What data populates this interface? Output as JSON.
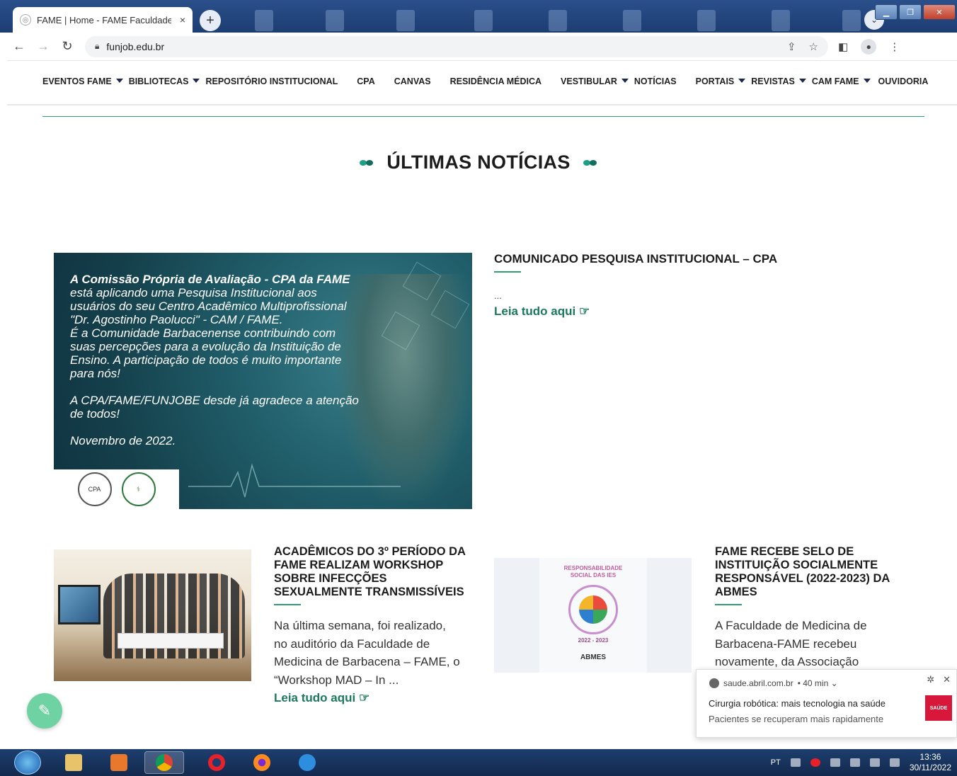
{
  "browser": {
    "tab_title": "FAME | Home - FAME Faculdade de",
    "tab_close": "×",
    "new_tab": "+",
    "url": "funjob.edu.br"
  },
  "nav": {
    "items": [
      {
        "label": "EVENTOS FAME",
        "dropdown": true
      },
      {
        "label": "BIBLIOTECAS",
        "dropdown": true
      },
      {
        "label": "REPOSITÓRIO INSTITUCIONAL",
        "dropdown": false
      },
      {
        "label": "CPA",
        "dropdown": false
      },
      {
        "label": "CANVAS",
        "dropdown": false
      },
      {
        "label": "RESIDÊNCIA MÉDICA",
        "dropdown": false
      },
      {
        "label": "VESTIBULAR",
        "dropdown": true
      },
      {
        "label": "NOTÍCIAS",
        "dropdown": false
      },
      {
        "label": "PORTAIS",
        "dropdown": true
      },
      {
        "label": "REVISTAS",
        "dropdown": true
      },
      {
        "label": "CAM FAME",
        "dropdown": true
      },
      {
        "label": "OUVIDORIA",
        "dropdown": false
      }
    ]
  },
  "section": {
    "heading": "ÚLTIMAS NOTÍCIAS"
  },
  "featured": {
    "image_text": {
      "line1": "A Comissão Própria de Avaliação - CPA da FAME",
      "line2": "está aplicando uma Pesquisa Institucional aos",
      "line3": "usuários do seu Centro Acadêmico Multiprofissional",
      "line4": "\"Dr. Agostinho Paolucci\" - CAM / FAME.",
      "line5": "É a Comunidade Barbacenense contribuindo com",
      "line6": "suas percepções para a evolução da Instituição de",
      "line7": "Ensino. A participação de todos é muito importante",
      "line8": "para nós!",
      "line9": "A CPA/FAME/FUNJOBE desde já agradece a atenção",
      "line10": "de todos!",
      "line11": "Novembro de 2022.",
      "logo1": "CPA"
    },
    "title": "COMUNICADO PESQUISA INSTITUCIONAL – CPA",
    "excerpt": "...",
    "read_more": "Leia tudo aqui"
  },
  "card1": {
    "title_l1": "ACADÊMICOS DO 3º PERÍODO DA",
    "title_l2": "FAME REALIZAM WORKSHOP",
    "title_l3": "SOBRE INFECÇÕES",
    "title_l4": "SEXUALMENTE TRANSMISSÍVEIS",
    "body_l1": "Na última semana, foi realizado,",
    "body_l2": "no auditório da Faculdade de",
    "body_l3": "Medicina de Barbacena – FAME, o",
    "body_l4": "“Workshop MAD – In ...",
    "read_more": "Leia tudo aqui"
  },
  "card2": {
    "image_text": {
      "rs1": "RESPONSABILIDADE",
      "rs2": "SOCIAL DAS IES",
      "years": "2022 - 2023",
      "abmes": "ABMES"
    },
    "title_l1": "FAME RECEBE SELO DE",
    "title_l2": "INSTITUIÇÃO SOCIALMENTE",
    "title_l3": "RESPONSÁVEL (2022-2023) DA",
    "title_l4": "ABMES",
    "body_l1": "A Faculdade de Medicina de",
    "body_l2": "Barbacena-FAME recebeu",
    "body_l3": "novamente, da Associação"
  },
  "notification": {
    "source": "saude.abril.com.br",
    "time": "• 40 min ⌄",
    "title": "Cirurgia robótica: mais tecnologia na saúde",
    "subtitle": "Pacientes se recuperam mais rapidamente",
    "thumb": "SAÚDE"
  },
  "taskbar": {
    "lang": "PT",
    "time": "13:36",
    "date": "30/11/2022"
  },
  "colors": {
    "accent_green": "#2f9e6e",
    "link_green": "#1b7a5c",
    "browser_frame": "#1d3d72"
  }
}
